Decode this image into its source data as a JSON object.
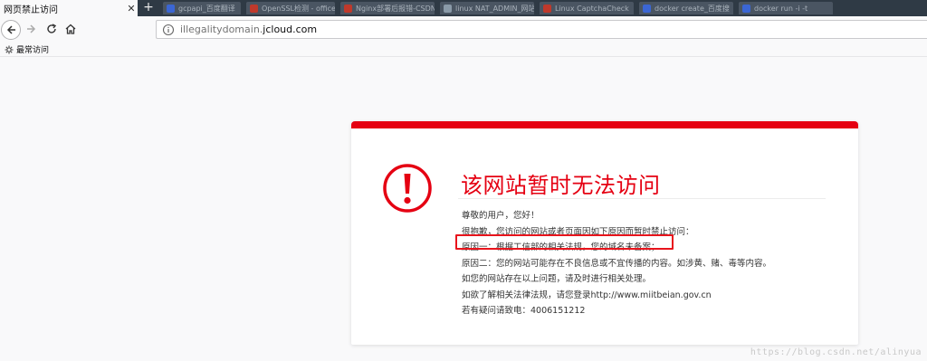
{
  "browser": {
    "active_tab": {
      "title": "网页禁止访问"
    },
    "background_tabs": [
      {
        "title": "gcpapi_百度翻译",
        "favicon_color": "#3b66d4"
      },
      {
        "title": "OpenSSL检测 - office证",
        "favicon_color": "#c0392b"
      },
      {
        "title": "Nginx部署后报错-CSDN",
        "favicon_color": "#c0392b"
      },
      {
        "title": "linux NAT_ADMIN_网站",
        "favicon_color": "#8a9aa8"
      },
      {
        "title": "Linux CaptchaCheck",
        "favicon_color": "#c0392b"
      },
      {
        "title": "docker create_百度搜",
        "favicon_color": "#3b66d4"
      },
      {
        "title": "docker run -i -t",
        "favicon_color": "#3b66d4"
      }
    ],
    "url": {
      "host_dim": "illegalitydomain.",
      "host_main": "jcloud.com"
    },
    "bookmarks": [
      {
        "label": "最常访问"
      }
    ]
  },
  "notice": {
    "title": "该网站暂时无法访问",
    "lines": [
      "尊敬的用户，您好！",
      "很抱歉，您访问的网站或者页面因如下原因而暂时禁止访问：",
      "原因一：根据工信部的相关法规，您的域名未备案；",
      "原因二：您的网站可能存在不良信息或不宜传播的内容。如涉黄、赌、毒等内容。",
      "如您的网站存在以上问题，请及时进行相关处理。",
      "如欲了解相关法律法规，请您登录http://www.miitbeian.gov.cn",
      "若有疑问请致电：4006151212"
    ],
    "accent_color": "#e50012"
  },
  "watermark": "https://blog.csdn.net/alinyua"
}
